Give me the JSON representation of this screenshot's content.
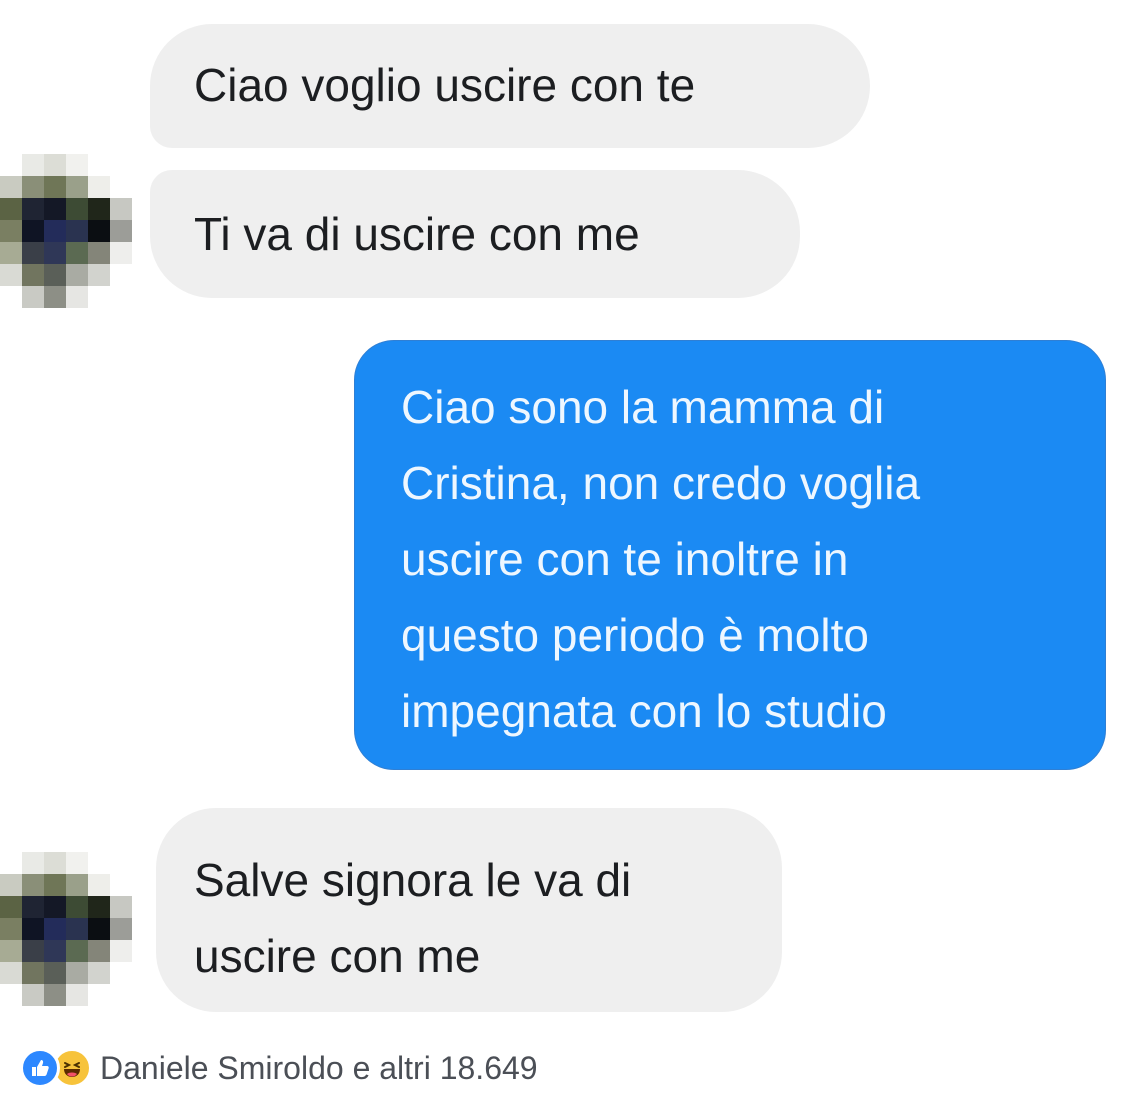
{
  "conversation": {
    "messages": [
      {
        "sender": "other",
        "lines": [
          "Ciao voglio uscire con te"
        ]
      },
      {
        "sender": "other",
        "lines": [
          "Ti va di uscire con me"
        ]
      },
      {
        "sender": "me",
        "lines": [
          "Ciao sono la mamma di",
          "Cristina, non credo voglia",
          "uscire con te inoltre in",
          "questo periodo è molto",
          "impegnata con lo studio"
        ]
      },
      {
        "sender": "other",
        "lines": [
          "Salve signora le va di",
          "uscire con me"
        ]
      }
    ]
  },
  "reactions": {
    "icons": [
      "like-icon",
      "haha-icon"
    ],
    "text": "Daniele Smiroldo e altri 18.649"
  },
  "colors": {
    "incoming_bubble": "#efefef",
    "outgoing_bubble": "#1b8af3",
    "outgoing_text": "#eef7ff",
    "like_blue": "#2d88ff",
    "haha_yellow": "#f7c33b"
  }
}
